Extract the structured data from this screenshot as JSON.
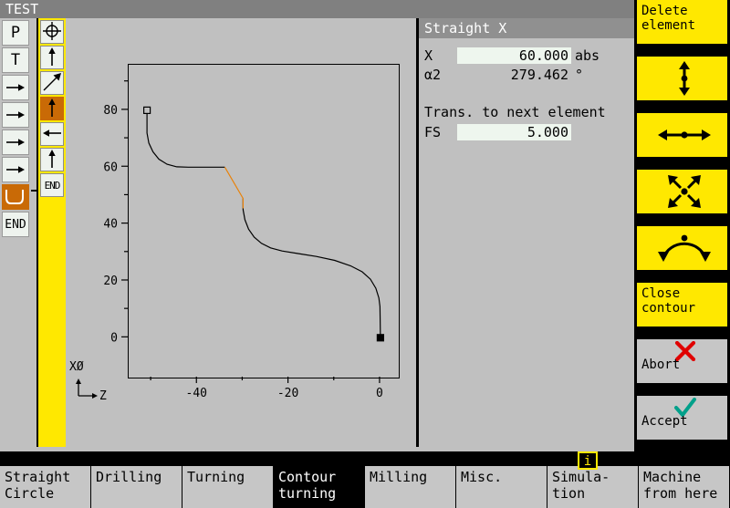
{
  "window": {
    "title": "TEST"
  },
  "program_steps": [
    {
      "name": "program-start",
      "glyph": "P",
      "selected": false
    },
    {
      "name": "tool",
      "glyph": "T",
      "selected": false
    },
    {
      "name": "linear-move-1",
      "glyph": "arrow-right",
      "selected": false
    },
    {
      "name": "linear-move-2",
      "glyph": "arrow-right",
      "selected": false
    },
    {
      "name": "linear-move-3",
      "glyph": "arrow-right",
      "selected": false
    },
    {
      "name": "linear-move-4",
      "glyph": "arrow-right",
      "selected": false
    },
    {
      "name": "contour-groove",
      "glyph": "contour",
      "selected": true
    },
    {
      "name": "program-end",
      "glyph": "END",
      "selected": false
    }
  ],
  "contour_elements": [
    {
      "name": "start-point",
      "glyph": "crosshair",
      "selected": false
    },
    {
      "name": "straight-vertical-1",
      "glyph": "arrow-up",
      "selected": false
    },
    {
      "name": "straight-diagonal",
      "glyph": "arrow-diagonal",
      "selected": false
    },
    {
      "name": "straight-x",
      "glyph": "arrow-up",
      "selected": true
    },
    {
      "name": "straight-z",
      "glyph": "arrow-left",
      "selected": false
    },
    {
      "name": "straight-vertical-2",
      "glyph": "arrow-up",
      "selected": false
    },
    {
      "name": "contour-end",
      "glyph": "END",
      "selected": false
    }
  ],
  "data_panel": {
    "title": "Straight X",
    "rows": [
      {
        "label": "X",
        "value": "60.000",
        "unit": "abs",
        "editable": true
      },
      {
        "label": "α2",
        "value": "279.462",
        "unit": "°",
        "editable": false
      }
    ],
    "section_title": "Trans. to next element",
    "transition": {
      "label": "FS",
      "value": "5.000",
      "unit": "",
      "editable": true
    }
  },
  "chart_data": {
    "type": "line",
    "title": "",
    "xlabel": "Z",
    "ylabel": "XØ",
    "corner_label": "XØ",
    "axis_indicator": {
      "vertical": "",
      "horizontal": "Z"
    },
    "xlim": [
      -55,
      4
    ],
    "ylim": [
      -14,
      96
    ],
    "xticks": [
      -40,
      -20,
      0
    ],
    "xticklabels": [
      "-40",
      "-20",
      "0"
    ],
    "xminorticks": [
      -50,
      -30,
      -10
    ],
    "yticks": [
      0,
      20,
      40,
      60,
      80
    ],
    "yticklabels": [
      "0",
      "20",
      "40",
      "60",
      "80"
    ],
    "yminorticks": [
      10,
      30,
      50,
      70,
      90
    ],
    "grid": false,
    "legend": "none",
    "markers": [
      {
        "name": "start-marker",
        "x": -51,
        "y": 80,
        "style": "open-square"
      },
      {
        "name": "end-marker",
        "x": 0,
        "y": 0,
        "style": "filled-square"
      }
    ],
    "series": [
      {
        "name": "contour-path",
        "color": "#000000",
        "points": [
          [
            -51,
            80
          ],
          [
            -51,
            72
          ],
          [
            -50.6,
            68.5
          ],
          [
            -49.7,
            65.4
          ],
          [
            -48.4,
            62.8
          ],
          [
            -46.6,
            61.0
          ],
          [
            -44.5,
            60.1
          ],
          [
            -42,
            60
          ],
          [
            -38,
            60
          ],
          [
            -34,
            60
          ]
        ]
      },
      {
        "name": "contour-path-tail",
        "color": "#000000",
        "points": [
          [
            -30,
            49
          ],
          [
            -30,
            45
          ],
          [
            -29.6,
            41.5
          ],
          [
            -28.8,
            38.2
          ],
          [
            -27.6,
            35.4
          ],
          [
            -26.0,
            33.2
          ],
          [
            -24.0,
            31.6
          ],
          [
            -21.5,
            30.5
          ],
          [
            -18,
            29.6
          ],
          [
            -14,
            28.6
          ],
          [
            -10,
            27.2
          ],
          [
            -6.5,
            25.3
          ],
          [
            -4.0,
            23.2
          ],
          [
            -2.2,
            20.6
          ],
          [
            -1.0,
            17.4
          ],
          [
            -0.35,
            14.0
          ],
          [
            -0.1,
            11.0
          ],
          [
            0,
            0
          ]
        ]
      },
      {
        "name": "selected-element",
        "color": "#e8820a",
        "points": [
          [
            -34,
            60
          ],
          [
            -30,
            49
          ],
          [
            -30,
            45.5
          ]
        ]
      }
    ]
  },
  "softkeys": [
    {
      "name": "delete-element",
      "label": "Delete\nelement",
      "icon": "none",
      "style": "yellow"
    },
    {
      "name": "zoom-vertical",
      "label": "",
      "icon": "arrows-vertical",
      "style": "yellow"
    },
    {
      "name": "zoom-horizontal",
      "label": "",
      "icon": "arrows-horizontal",
      "style": "yellow"
    },
    {
      "name": "zoom-all",
      "label": "",
      "icon": "arrows-diagonal",
      "style": "yellow"
    },
    {
      "name": "arc-direction",
      "label": "",
      "icon": "arc-arrows",
      "style": "yellow"
    },
    {
      "name": "close-contour",
      "label": "Close\ncontour",
      "icon": "none",
      "style": "yellow"
    },
    {
      "name": "abort",
      "label": "Abort",
      "icon": "red-cross",
      "style": "grey"
    },
    {
      "name": "accept",
      "label": "Accept",
      "icon": "green-check",
      "style": "grey"
    }
  ],
  "tabs": [
    {
      "name": "straight-circle",
      "label": "Straight\nCircle",
      "active": false
    },
    {
      "name": "drilling",
      "label": "Drilling",
      "active": false
    },
    {
      "name": "turning",
      "label": "Turning",
      "active": false
    },
    {
      "name": "contour-turning",
      "label": "Contour\nturning",
      "active": true
    },
    {
      "name": "milling",
      "label": "Milling",
      "active": false
    },
    {
      "name": "misc",
      "label": "Misc.",
      "active": false
    },
    {
      "name": "simulation",
      "label": "Simula-\ntion",
      "active": false
    },
    {
      "name": "machine-from-here",
      "label": "Machine\nfrom here",
      "active": false
    }
  ],
  "info_badge": {
    "label": "i"
  },
  "colors": {
    "accent_yellow": "#ffe800",
    "selection_orange": "#c96a06",
    "highlight_orange": "#e8820a",
    "panel_grey": "#c0c0c0",
    "titlebar_grey": "#808080",
    "abort_red": "#e00000",
    "accept_green": "#00a08a"
  }
}
